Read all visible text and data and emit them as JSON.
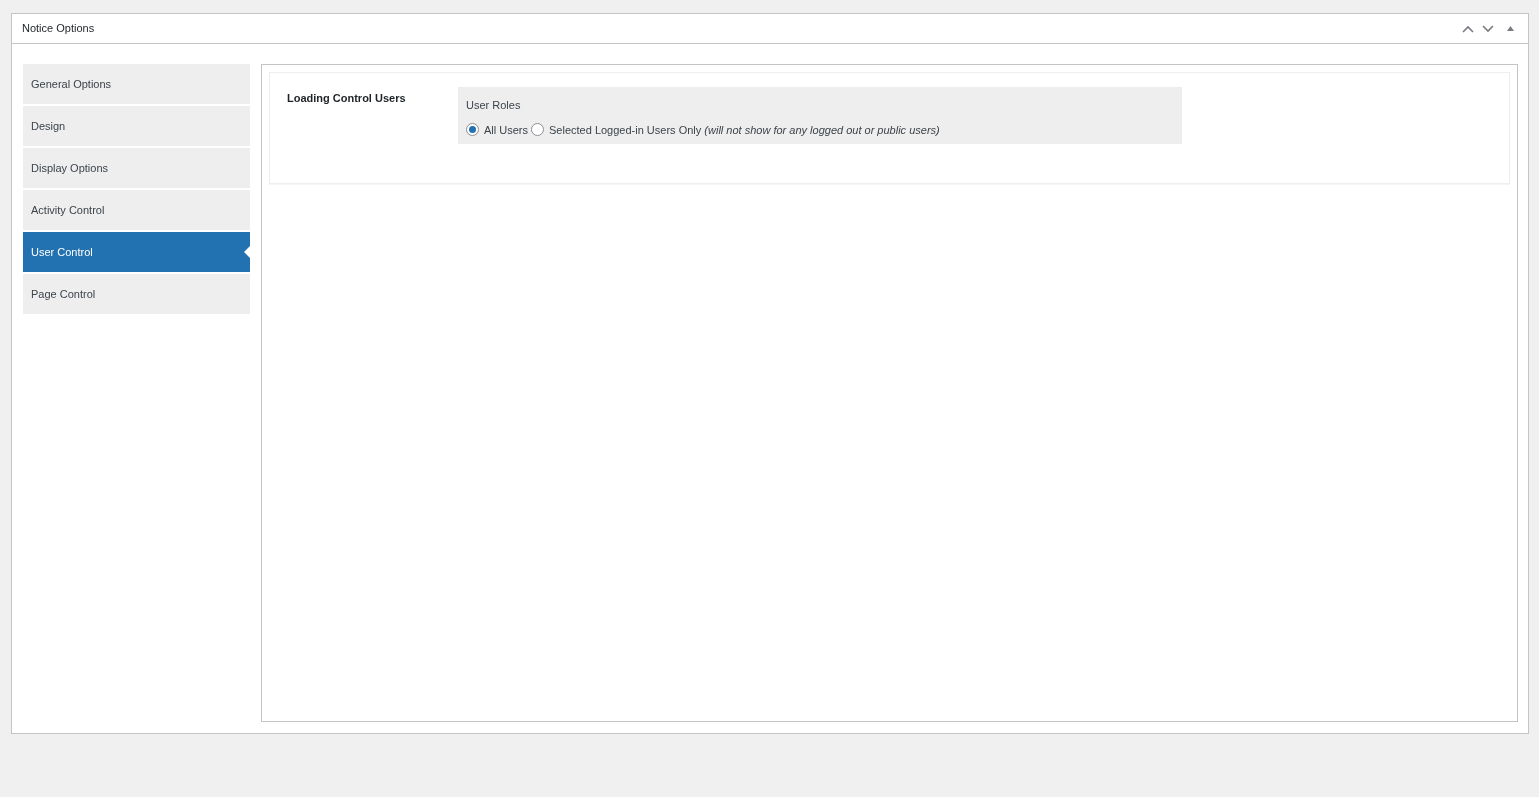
{
  "panel": {
    "title": "Notice Options"
  },
  "tabs": [
    {
      "label": "General Options",
      "selected": false
    },
    {
      "label": "Design",
      "selected": false
    },
    {
      "label": "Display Options",
      "selected": false
    },
    {
      "label": "Activity Control",
      "selected": false
    },
    {
      "label": "User Control",
      "selected": true
    },
    {
      "label": "Page Control",
      "selected": false
    }
  ],
  "setting": {
    "label": "Loading Control Users",
    "group_label": "User Roles",
    "options": [
      {
        "label": "All Users",
        "selected": true
      },
      {
        "label": "Selected Logged-in Users Only *(will not show for any logged out or public users)*",
        "selected": false
      }
    ]
  }
}
